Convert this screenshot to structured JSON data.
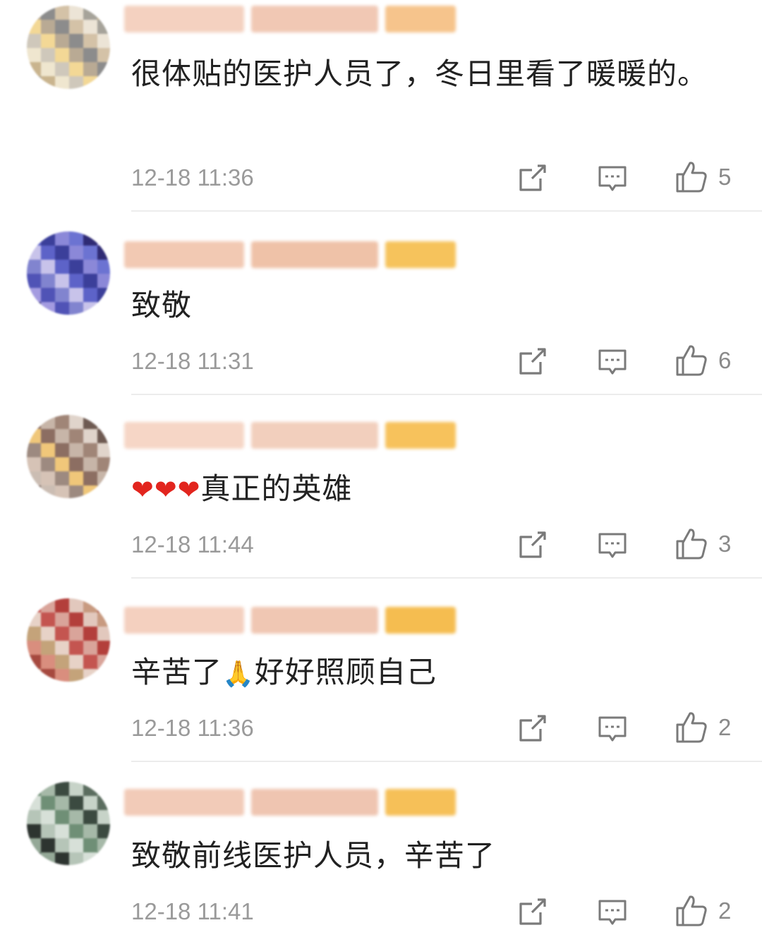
{
  "comments": [
    {
      "text": "很体贴的医护人员了，冬日里看了暖暖的。",
      "time": "12-18 11:36",
      "likes": "5",
      "avatar_colors": [
        "#b9aa94",
        "#8c8c8c",
        "#d4c2a7",
        "#ece4d6",
        "#a6a39a",
        "#c9b48e",
        "#efe6cf",
        "#cfc8bb",
        "#f3d896"
      ],
      "name_colors": [
        "#f4d1c0",
        "#f1c8b4",
        "#f6c48c"
      ]
    },
    {
      "text": "致敬",
      "time": "12-18 11:31",
      "likes": "6",
      "avatar_colors": [
        "#5d63c8",
        "#3b3f9a",
        "#8b88d8",
        "#6c73d2",
        "#2f2b74",
        "#a49be0",
        "#5053b6",
        "#8184cf",
        "#c8c3ea"
      ],
      "name_colors": [
        "#f2c9b3",
        "#efc2a8",
        "#f6c35c"
      ]
    },
    {
      "text_hearts": "❤❤❤",
      "text": "真正的英雄",
      "time": "12-18 11:44",
      "likes": "3",
      "avatar_colors": [
        "#8c6e62",
        "#c7b5a8",
        "#a08577",
        "#e0d4cb",
        "#6e5a52",
        "#cbbdb3",
        "#d6c3b6",
        "#9d8a80",
        "#f0c77a"
      ],
      "name_colors": [
        "#f6d6c6",
        "#f2cfbd",
        "#f7c25c"
      ]
    },
    {
      "text_pre": "辛苦了",
      "text_emoji": "🙏",
      "text": "好好照顾自己",
      "time": "12-18 11:36",
      "likes": "2",
      "avatar_colors": [
        "#c45550",
        "#d9a49a",
        "#b33f3b",
        "#e2c8bd",
        "#c89a80",
        "#a6493f",
        "#d98e7e",
        "#c4a37a",
        "#e7d2c7"
      ],
      "name_colors": [
        "#f4d0bf",
        "#f0c7b3",
        "#f5bd50"
      ]
    },
    {
      "text": "致敬前线医护人员，辛苦了",
      "time": "12-18 11:41",
      "likes": "2",
      "avatar_colors": [
        "#6f8f76",
        "#a6b9a8",
        "#3b4a40",
        "#c7d3c8",
        "#5b6d5f",
        "#94a897",
        "#2d3430",
        "#b6c5b8",
        "#d7e0d8"
      ],
      "name_colors": [
        "#f2cbb8",
        "#efc5b1",
        "#f6c058"
      ]
    }
  ],
  "icons": {
    "forward": "forward-icon",
    "comment": "comment-icon",
    "like": "thumbs-up-icon"
  }
}
